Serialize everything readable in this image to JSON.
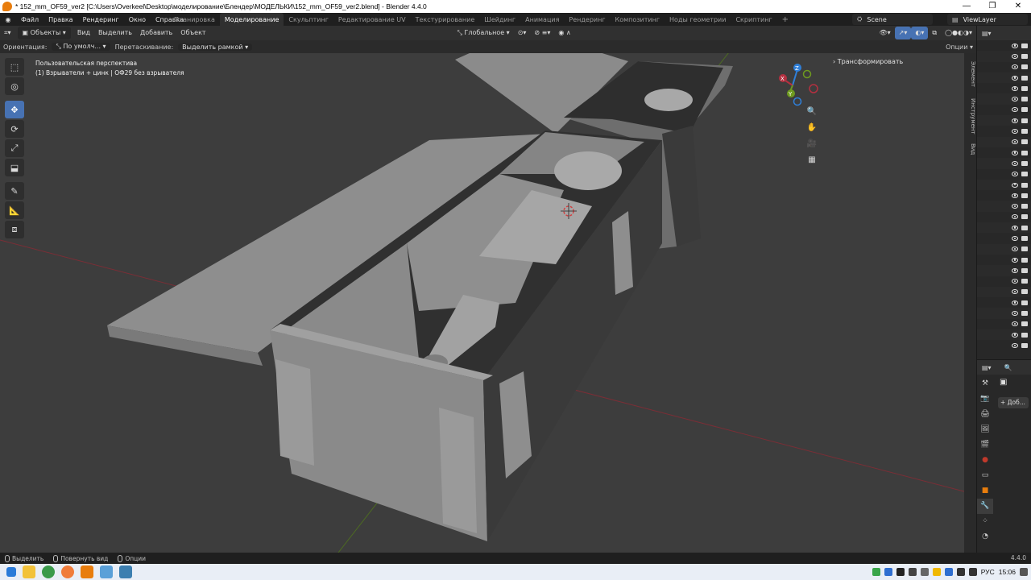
{
  "window": {
    "title": "* 152_mm_OF59_ver2 [C:\\Users\\Overkeel\\Desktop\\моделирование\\Блендер\\МОДЕЛЬКИ\\152_mm_OF59_ver2.blend] - Blender 4.4.0",
    "minimize": "—",
    "maximize": "❐",
    "close": "✕"
  },
  "menu": {
    "items": [
      "Файл",
      "Правка",
      "Рендеринг",
      "Окно",
      "Справка"
    ]
  },
  "workspaces": {
    "tabs": [
      "Планировка",
      "Моделирование",
      "Скульптинг",
      "Редактирование UV",
      "Текстурирование",
      "Шейдинг",
      "Анимация",
      "Рендеринг",
      "Композитинг",
      "Ноды геометрии",
      "Скриптинг"
    ],
    "active": "Моделирование",
    "add": "+"
  },
  "scene": {
    "name": "Scene",
    "view_layer": "ViewLayer"
  },
  "header": {
    "mode": "Объекты",
    "menus": [
      "Вид",
      "Выделить",
      "Добавить",
      "Объект"
    ],
    "transform_orientation": "Глобальное"
  },
  "tool_settings": {
    "orientation_label": "Ориентация:",
    "orientation_value": "По умолч...",
    "drag_label": "Перетаскивание:",
    "drag_value": "Выделить рамкой",
    "options": "Опции"
  },
  "viewport": {
    "view_name": "Пользовательская перспектива",
    "object_info": "(1) Взрыватели + цинк | ОФ29 без взрывателя",
    "gizmo_axes": {
      "x": "X",
      "y": "Y",
      "z": "Z"
    },
    "colors": {
      "background": "#3d3d3d",
      "x_axis": "#b33040",
      "y_axis": "#6e9a1f",
      "z_axis": "#2f7fd8",
      "active_tool": "#4772b3"
    }
  },
  "toolbar": {
    "tools": [
      "select-box-icon",
      "cursor-icon",
      "move-icon",
      "rotate-icon",
      "scale-icon",
      "transform-icon",
      "annotate-icon",
      "measure-icon",
      "add-cube-icon"
    ],
    "active_tool": "move-icon"
  },
  "npanel": {
    "section": "Трансформировать",
    "tabs": [
      "Элемент",
      "Инструмент",
      "Вид"
    ]
  },
  "properties": {
    "add_modifier": "+ Доб..."
  },
  "statusbar": {
    "select": "Выделить",
    "rotate": "Повернуть вид",
    "options": "Опции",
    "version": "4.4.0"
  },
  "taskbar": {
    "language": "РУС",
    "time": "15:06"
  }
}
